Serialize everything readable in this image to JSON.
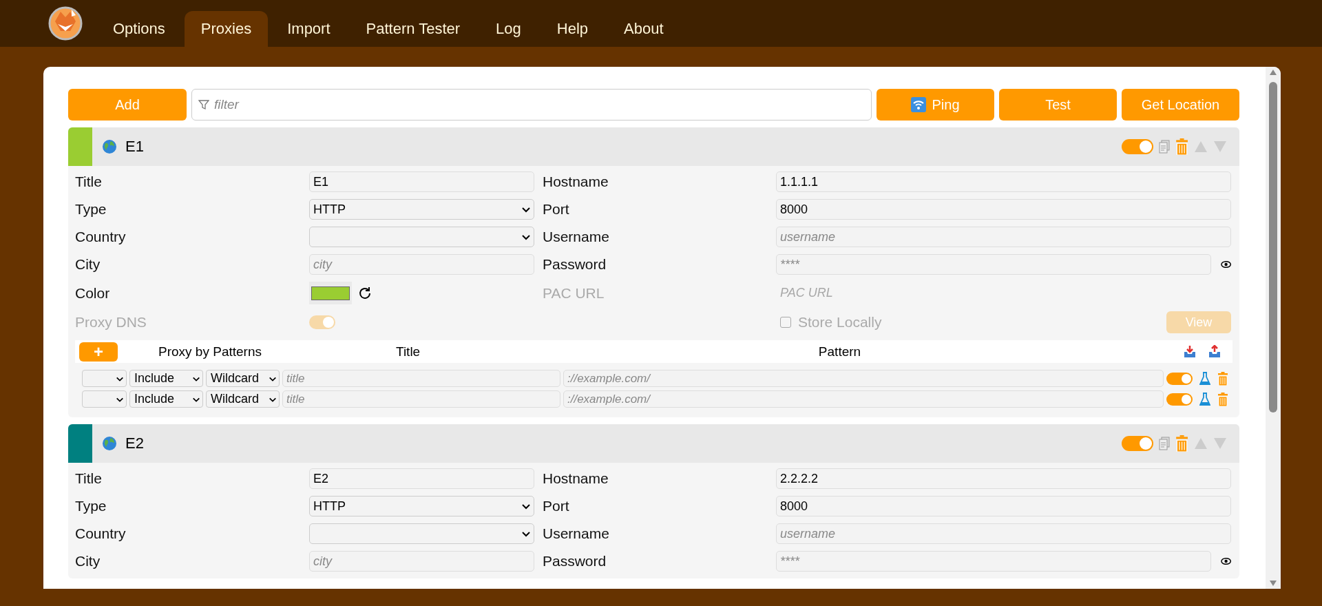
{
  "nav": {
    "tabs": [
      {
        "label": "Options",
        "selected": false
      },
      {
        "label": "Proxies",
        "selected": true
      },
      {
        "label": "Import",
        "selected": false
      },
      {
        "label": "Pattern Tester",
        "selected": false
      },
      {
        "label": "Log",
        "selected": false
      },
      {
        "label": "Help",
        "selected": false
      },
      {
        "label": "About",
        "selected": false
      }
    ]
  },
  "toolbar": {
    "add": "Add",
    "filter": {
      "placeholder": "filter"
    },
    "buttons": [
      {
        "label": "Ping",
        "kind": "wifi"
      },
      {
        "label": "Test",
        "kind": "plain"
      },
      {
        "label": "Get Location",
        "kind": "plain"
      }
    ]
  },
  "proxies": [
    {
      "title": "E1",
      "color": "#9acd32",
      "enabled": true,
      "left": [
        {
          "label": "Title",
          "kind": "text",
          "value": "E1"
        },
        {
          "label": "Type",
          "kind": "select",
          "value": "HTTP"
        },
        {
          "label": "Country",
          "kind": "select"
        },
        {
          "label": "City",
          "kind": "text",
          "placeholder": "city"
        },
        {
          "label": "Color",
          "kind": "color",
          "color": "#9acd32"
        },
        {
          "label": "Proxy DNS",
          "kind": "toggle",
          "on": true,
          "disabled": true
        }
      ],
      "right": [
        {
          "label": "Hostname",
          "kind": "text",
          "value": "1.1.1.1"
        },
        {
          "label": "Port",
          "kind": "text",
          "value": "8000"
        },
        {
          "label": "Username",
          "kind": "text",
          "placeholder": "username"
        },
        {
          "label": "Password",
          "kind": "password",
          "placeholder": "****"
        },
        {
          "label": "PAC URL",
          "kind": "text",
          "placeholder": "PAC URL",
          "disabled": true
        },
        {
          "label": "Store Locally",
          "kind": "checkbox",
          "checked": false,
          "disabled": true,
          "button": "View"
        }
      ],
      "patterns": {
        "add": "+",
        "columns": [
          "Proxy by Patterns",
          "Title",
          "Pattern"
        ],
        "rows": [
          {
            "action": "Include",
            "type": "Wildcard",
            "title_placeholder": "title",
            "pattern_placeholder": "://example.com/",
            "on": true
          },
          {
            "action": "Include",
            "type": "Wildcard",
            "title_placeholder": "title",
            "pattern_placeholder": "://example.com/",
            "on": true
          }
        ]
      }
    },
    {
      "title": "E2",
      "color": "#008080",
      "enabled": true,
      "left": [
        {
          "label": "Title",
          "kind": "text",
          "value": "E2"
        },
        {
          "label": "Type",
          "kind": "select",
          "value": "HTTP"
        },
        {
          "label": "Country",
          "kind": "select"
        },
        {
          "label": "City",
          "kind": "text",
          "placeholder": "city"
        }
      ],
      "right": [
        {
          "label": "Hostname",
          "kind": "text",
          "value": "2.2.2.2"
        },
        {
          "label": "Port",
          "kind": "text",
          "value": "8000"
        },
        {
          "label": "Username",
          "kind": "text",
          "placeholder": "username"
        },
        {
          "label": "Password",
          "kind": "password",
          "placeholder": "****"
        }
      ]
    }
  ]
}
